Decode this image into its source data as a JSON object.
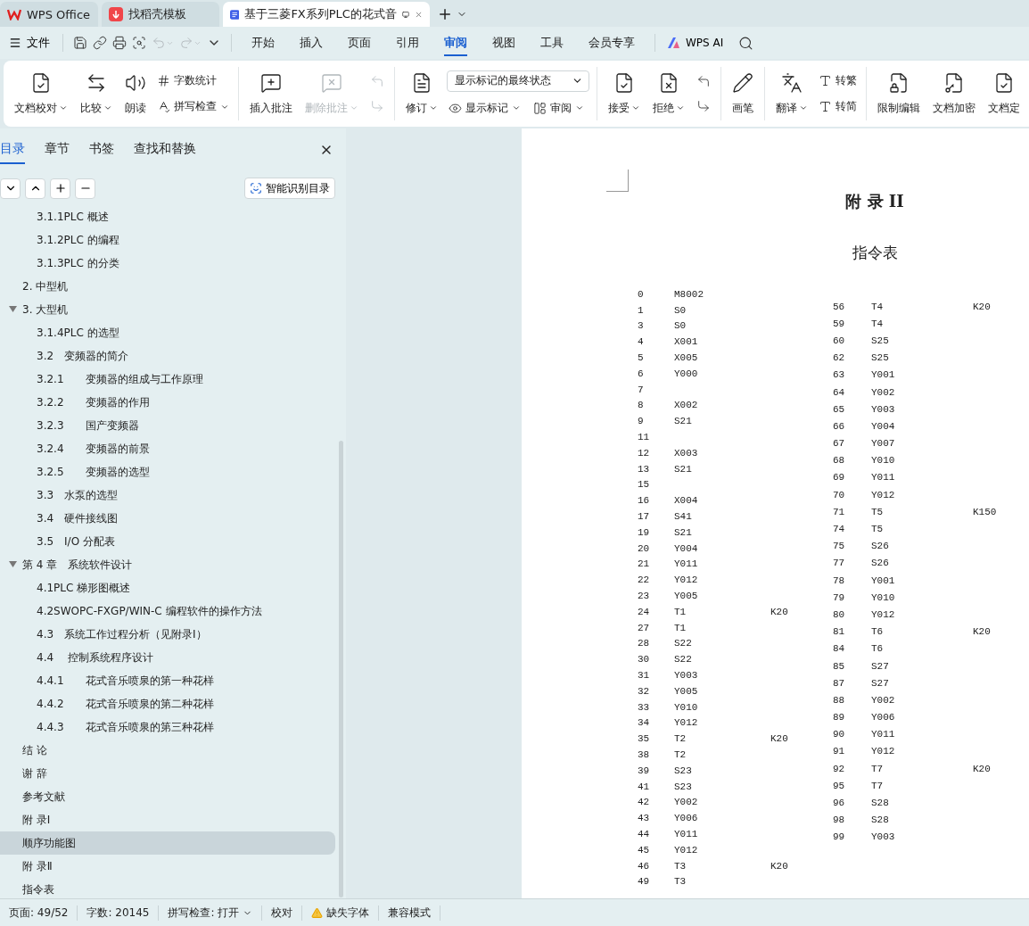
{
  "tabs": [
    {
      "kind": "app",
      "label": "WPS Office",
      "selected": false
    },
    {
      "kind": "template",
      "label": "找稻壳模板",
      "selected": false
    },
    {
      "kind": "doc",
      "label": "基于三菱FX系列PLC的花式音",
      "selected": true
    }
  ],
  "menu": {
    "file": "文件",
    "tabs": [
      {
        "label": "开始",
        "selected": false
      },
      {
        "label": "插入",
        "selected": false
      },
      {
        "label": "页面",
        "selected": false
      },
      {
        "label": "引用",
        "selected": false
      },
      {
        "label": "审阅",
        "selected": true
      },
      {
        "label": "视图",
        "selected": false
      },
      {
        "label": "工具",
        "selected": false
      },
      {
        "label": "会员专享",
        "selected": false
      }
    ],
    "ai": "WPS AI"
  },
  "ribbon": [
    {
      "items": [
        {
          "kind": "large",
          "label": "文档校对",
          "dropdown": true,
          "disabled": false
        },
        {
          "kind": "large",
          "label": "比较",
          "dropdown": true,
          "disabled": false
        },
        {
          "kind": "large",
          "label": "朗读",
          "dropdown": false,
          "disabled": false
        },
        {
          "kind": "stack",
          "items": [
            {
              "label": "字数统计",
              "dropdown": false,
              "disabled": false
            },
            {
              "label": "拼写检查",
              "dropdown": true,
              "disabled": false
            }
          ]
        }
      ]
    },
    {
      "items": [
        {
          "kind": "large",
          "label": "插入批注",
          "dropdown": false,
          "disabled": false
        },
        {
          "kind": "large",
          "label": "删除批注",
          "dropdown": true,
          "disabled": true
        },
        {
          "kind": "iconstack",
          "disabled": true
        }
      ]
    },
    {
      "items": [
        {
          "kind": "large",
          "label": "修订",
          "dropdown": true,
          "disabled": false
        },
        {
          "kind": "select",
          "value": "显示标记的最终状态",
          "items": [
            {
              "label": "显示标记",
              "dropdown": true,
              "disabled": false
            },
            {
              "label": "审阅",
              "dropdown": true,
              "disabled": false
            }
          ]
        }
      ]
    },
    {
      "items": [
        {
          "kind": "large",
          "label": "接受",
          "dropdown": true,
          "disabled": false
        },
        {
          "kind": "large",
          "label": "拒绝",
          "dropdown": true,
          "disabled": false
        },
        {
          "kind": "iconstack",
          "disabled": false
        }
      ]
    },
    {
      "items": [
        {
          "kind": "large",
          "label": "画笔",
          "dropdown": false,
          "disabled": false
        }
      ]
    },
    {
      "items": [
        {
          "kind": "large",
          "label": "翻译",
          "dropdown": true,
          "disabled": false
        },
        {
          "kind": "stack",
          "items": [
            {
              "label": "转繁",
              "dropdown": false,
              "disabled": false
            },
            {
              "label": "转简",
              "dropdown": false,
              "disabled": false
            }
          ]
        }
      ]
    },
    {
      "items": [
        {
          "kind": "large",
          "label": "限制编辑",
          "dropdown": false,
          "disabled": false
        },
        {
          "kind": "large",
          "label": "文档加密",
          "dropdown": false,
          "disabled": false
        },
        {
          "kind": "large",
          "label": "文档定",
          "dropdown": false,
          "disabled": false
        }
      ]
    }
  ],
  "sidebar": {
    "tabs": [
      {
        "label": "目录",
        "selected": true
      },
      {
        "label": "章节",
        "selected": false
      },
      {
        "label": "书签",
        "selected": false
      },
      {
        "label": "查找和替换",
        "selected": false
      }
    ],
    "smart_button": "智能识别目录",
    "outline": [
      {
        "children": [
          {
            "label": "3.1.1PLC 概述",
            "selected": false
          },
          {
            "label": "3.1.2PLC 的编程",
            "selected": false
          },
          {
            "label": "3.1.3PLC 的分类",
            "selected": false
          }
        ]
      },
      {
        "label": "2. 中型机",
        "selected": false
      },
      {
        "label": "3. 大型机",
        "selected": false,
        "expanded": true,
        "children": [
          {
            "label": "3.1.4PLC 的选型",
            "selected": false
          },
          {
            "label": "3.2　变频器的简介",
            "selected": false
          },
          {
            "label": "3.2.1　　变频器的组成与工作原理",
            "selected": false
          },
          {
            "label": "3.2.2　　变频器的作用",
            "selected": false
          },
          {
            "label": "3.2.3　　国产变频器",
            "selected": false
          },
          {
            "label": "3.2.4　　变频器的前景",
            "selected": false
          },
          {
            "label": "3.2.5　　变频器的选型",
            "selected": false
          },
          {
            "label": "3.3　水泵的选型",
            "selected": false
          },
          {
            "label": "3.4　硬件接线图",
            "selected": false
          },
          {
            "label": "3.5　I/O 分配表",
            "selected": false
          }
        ]
      },
      {
        "label": "第 4 章　系统软件设计",
        "selected": false,
        "expanded": true,
        "children": [
          {
            "label": "4.1PLC 梯形图概述",
            "selected": false
          },
          {
            "label": "4.2SWOPC-FXGP/WIN-C 编程软件的操作方法",
            "selected": false
          },
          {
            "label": "4.3　系统工作过程分析（见附录Ⅰ）",
            "selected": false
          },
          {
            "label": "4.4　 控制系统程序设计",
            "selected": false
          },
          {
            "label": "4.4.1　　花式音乐喷泉的第一种花样",
            "selected": false
          },
          {
            "label": "4.4.2　　花式音乐喷泉的第二种花样",
            "selected": false
          },
          {
            "label": "4.4.3　　花式音乐喷泉的第三种花样",
            "selected": false
          }
        ]
      },
      {
        "label": "结 论",
        "selected": false
      },
      {
        "label": "谢 辞",
        "selected": false
      },
      {
        "label": "参考文献",
        "selected": false
      },
      {
        "label": "附 录Ⅰ",
        "selected": false
      },
      {
        "label": "顺序功能图",
        "selected": true
      },
      {
        "label": "附 录Ⅱ",
        "selected": false
      },
      {
        "label": "指令表",
        "selected": false
      }
    ]
  },
  "document": {
    "title": "附 录 II",
    "subtitle": "指令表",
    "left": [
      {
        "n": "0",
        "op": "M8002"
      },
      {
        "n": "1",
        "op": "S0"
      },
      {
        "n": "3",
        "op": "S0"
      },
      {
        "n": "4",
        "op": "X001"
      },
      {
        "n": "5",
        "op": "X005"
      },
      {
        "n": "6",
        "op": "Y000"
      },
      {
        "n": "7"
      },
      {
        "n": "8",
        "op": "X002"
      },
      {
        "n": "9",
        "op": "S21"
      },
      {
        "n": "11"
      },
      {
        "n": "12",
        "op": "X003"
      },
      {
        "n": "13",
        "op": "S21"
      },
      {
        "n": "15"
      },
      {
        "n": "16",
        "op": "X004"
      },
      {
        "n": "17",
        "op": "S41"
      },
      {
        "n": "19",
        "op": "S21"
      },
      {
        "n": "20",
        "op": "Y004"
      },
      {
        "n": "21",
        "op": "Y011"
      },
      {
        "n": "22",
        "op": "Y012"
      },
      {
        "n": "23",
        "op": "Y005"
      },
      {
        "n": "24",
        "op": "T1",
        "k": "K20"
      },
      {
        "n": "27",
        "op": "T1"
      },
      {
        "n": "28",
        "op": "S22"
      },
      {
        "n": "30",
        "op": "S22"
      },
      {
        "n": "31",
        "op": "Y003"
      },
      {
        "n": "32",
        "op": "Y005"
      },
      {
        "n": "33",
        "op": "Y010"
      },
      {
        "n": "34",
        "op": "Y012"
      },
      {
        "n": "35",
        "op": "T2",
        "k": "K20"
      },
      {
        "n": "38",
        "op": "T2"
      },
      {
        "n": "39",
        "op": "S23"
      },
      {
        "n": "41",
        "op": "S23"
      },
      {
        "n": "42",
        "op": "Y002"
      },
      {
        "n": "43",
        "op": "Y006"
      },
      {
        "n": "44",
        "op": "Y011"
      },
      {
        "n": "45",
        "op": "Y012"
      },
      {
        "n": "46",
        "op": "T3",
        "k": "K20"
      },
      {
        "n": "49",
        "op": "T3"
      }
    ],
    "right": [
      {
        "n": "56",
        "op": "T4",
        "k": "K20"
      },
      {
        "n": "59",
        "op": "T4"
      },
      {
        "n": "60",
        "op": "S25"
      },
      {
        "n": "62",
        "op": "S25"
      },
      {
        "n": "63",
        "op": "Y001"
      },
      {
        "n": "64",
        "op": "Y002"
      },
      {
        "n": "65",
        "op": "Y003"
      },
      {
        "n": "66",
        "op": "Y004"
      },
      {
        "n": "67",
        "op": "Y007"
      },
      {
        "n": "68",
        "op": "Y010"
      },
      {
        "n": "69",
        "op": "Y011"
      },
      {
        "n": "70",
        "op": "Y012"
      },
      {
        "n": "71",
        "op": "T5",
        "k": "K150"
      },
      {
        "n": "74",
        "op": "T5"
      },
      {
        "n": "75",
        "op": "S26"
      },
      {
        "n": "77",
        "op": "S26"
      },
      {
        "n": "78",
        "op": "Y001"
      },
      {
        "n": "79",
        "op": "Y010"
      },
      {
        "n": "80",
        "op": "Y012"
      },
      {
        "n": "81",
        "op": "T6",
        "k": "K20"
      },
      {
        "n": "84",
        "op": "T6"
      },
      {
        "n": "85",
        "op": "S27"
      },
      {
        "n": "87",
        "op": "S27"
      },
      {
        "n": "88",
        "op": "Y002"
      },
      {
        "n": "89",
        "op": "Y006"
      },
      {
        "n": "90",
        "op": "Y011"
      },
      {
        "n": "91",
        "op": "Y012"
      },
      {
        "n": "92",
        "op": "T7",
        "k": "K20"
      },
      {
        "n": "95",
        "op": "T7"
      },
      {
        "n": "96",
        "op": "S28"
      },
      {
        "n": "98",
        "op": "S28"
      },
      {
        "n": "99",
        "op": "Y003"
      }
    ]
  },
  "status_bar": [
    {
      "kind": "text",
      "label": "页面: 49/52"
    },
    {
      "kind": "text",
      "label": "字数: 20145"
    },
    {
      "kind": "dropdown",
      "label": "拼写检查: 打开"
    },
    {
      "kind": "text",
      "label": "校对"
    },
    {
      "kind": "warning",
      "label": "缺失字体"
    },
    {
      "kind": "text",
      "label": "兼容模式"
    }
  ]
}
